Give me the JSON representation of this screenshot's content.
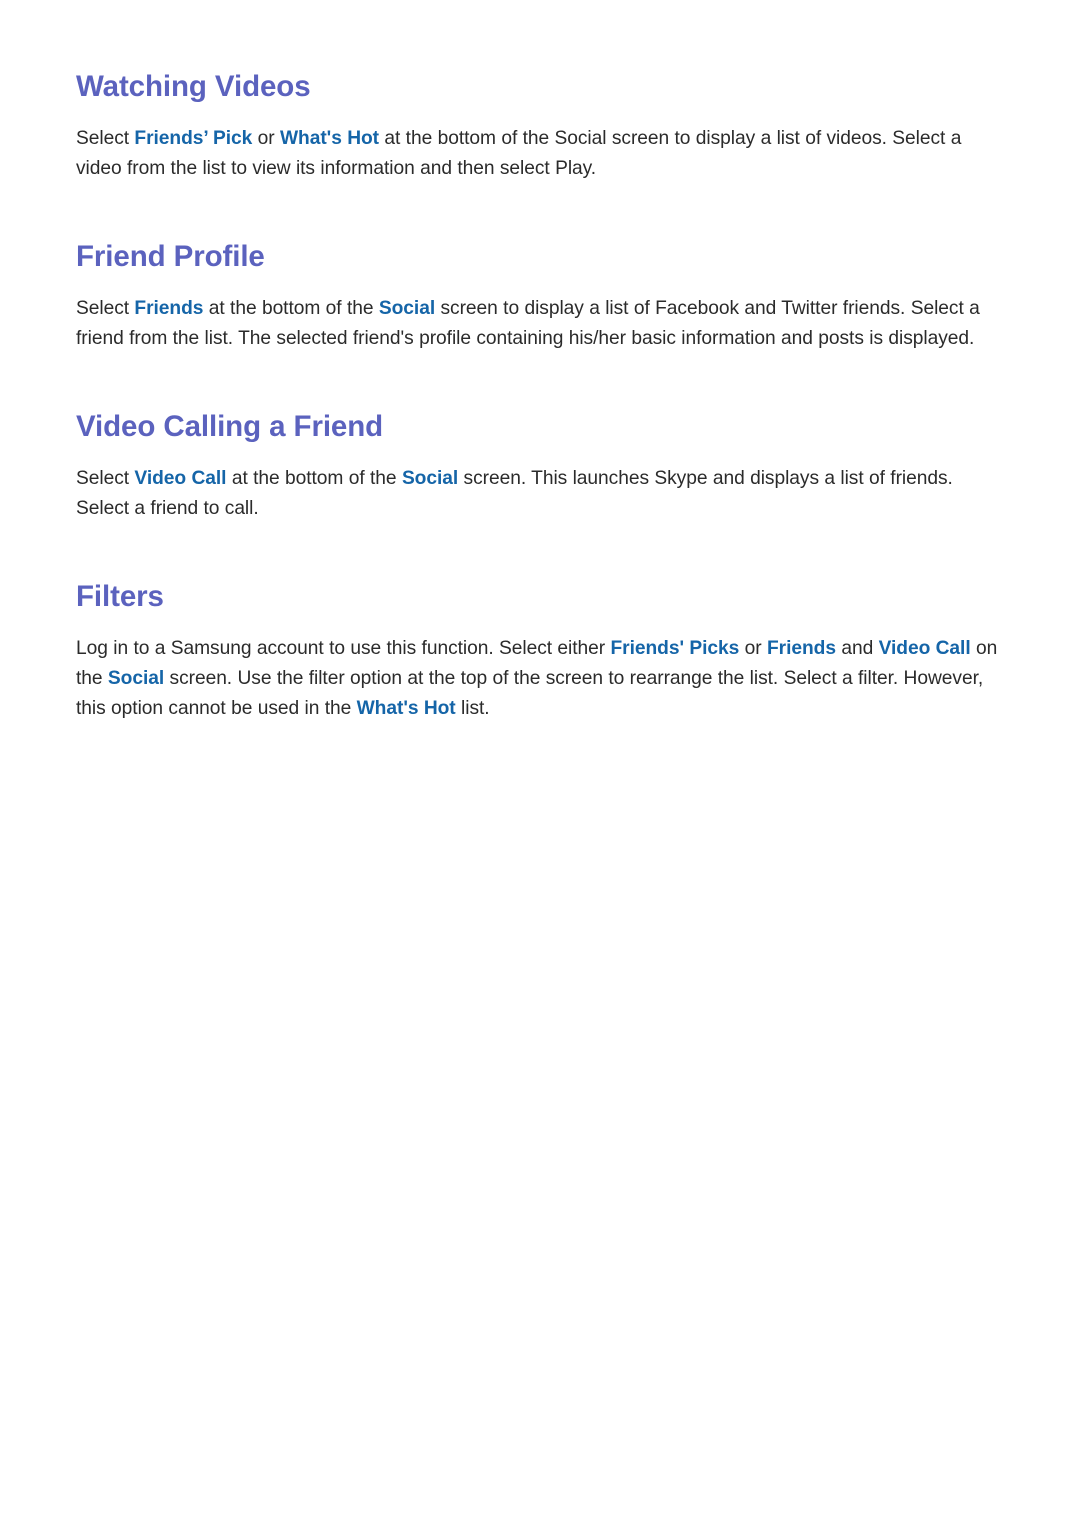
{
  "document": {
    "page_background": "#ffffff",
    "heading_color": "#5b62be",
    "body_color": "#2b2b2b",
    "highlight_color": "#1565a8",
    "sections": [
      {
        "id": "watching-videos",
        "heading": "Watching Videos",
        "body_runs": [
          {
            "text": "Select ",
            "style": "normal"
          },
          {
            "text": "Friends’ Pick",
            "style": "highlight"
          },
          {
            "text": " or ",
            "style": "normal"
          },
          {
            "text": "What's Hot",
            "style": "highlight"
          },
          {
            "text": " at the bottom of the Social screen to display a list of videos. Select a video from the list to view its information and then select Play.",
            "style": "normal"
          }
        ],
        "body_plain": "Select Friends’ Pick or What's Hot at the bottom of the Social screen to display a list of videos. Select a video from the list to view its information and then select Play."
      },
      {
        "id": "friend-profile",
        "heading": "Friend Profile",
        "body_runs": [
          {
            "text": "Select ",
            "style": "normal"
          },
          {
            "text": "Friends",
            "style": "highlight"
          },
          {
            "text": " at the bottom of the ",
            "style": "normal"
          },
          {
            "text": "Social",
            "style": "highlight"
          },
          {
            "text": " screen to display a list of Facebook and Twitter friends. Select a friend from the list. The selected friend's profile containing his/her basic information and posts is displayed.",
            "style": "normal"
          }
        ],
        "body_plain": "Select Friends at the bottom of the Social screen to display a list of Facebook and Twitter friends. Select a friend from the list. The selected friend's profile containing his/her basic information and posts is displayed."
      },
      {
        "id": "video-calling-a-friend",
        "heading": "Video Calling a Friend",
        "body_runs": [
          {
            "text": "Select ",
            "style": "normal"
          },
          {
            "text": "Video Call",
            "style": "highlight"
          },
          {
            "text": " at the bottom of the ",
            "style": "normal"
          },
          {
            "text": "Social",
            "style": "highlight"
          },
          {
            "text": " screen. This launches Skype and displays a list of friends. Select a friend to call.",
            "style": "normal"
          }
        ],
        "body_plain": "Select Video Call at the bottom of the Social screen. This launches Skype and displays a list of friends. Select a friend to call."
      },
      {
        "id": "filters",
        "heading": "Filters",
        "body_runs": [
          {
            "text": "Log in to a Samsung account to use this function. Select either ",
            "style": "normal"
          },
          {
            "text": "Friends' Picks",
            "style": "highlight"
          },
          {
            "text": " or ",
            "style": "normal"
          },
          {
            "text": "Friends",
            "style": "highlight"
          },
          {
            "text": " and ",
            "style": "normal"
          },
          {
            "text": "Video Call",
            "style": "highlight"
          },
          {
            "text": " on the ",
            "style": "normal"
          },
          {
            "text": "Social",
            "style": "highlight"
          },
          {
            "text": " screen. Use the filter option at the top of the screen to rearrange the list. Select a filter. However, this option cannot be used in the ",
            "style": "normal"
          },
          {
            "text": "What's Hot",
            "style": "highlight"
          },
          {
            "text": " list.",
            "style": "normal"
          }
        ],
        "body_plain": "Log in to a Samsung account to use this function. Select either Friends' Picks or Friends and Video Call on the Social screen. Use the filter option at the top of the screen to rearrange the list. Select a filter. However, this option cannot be used in the What's Hot list."
      }
    ]
  }
}
